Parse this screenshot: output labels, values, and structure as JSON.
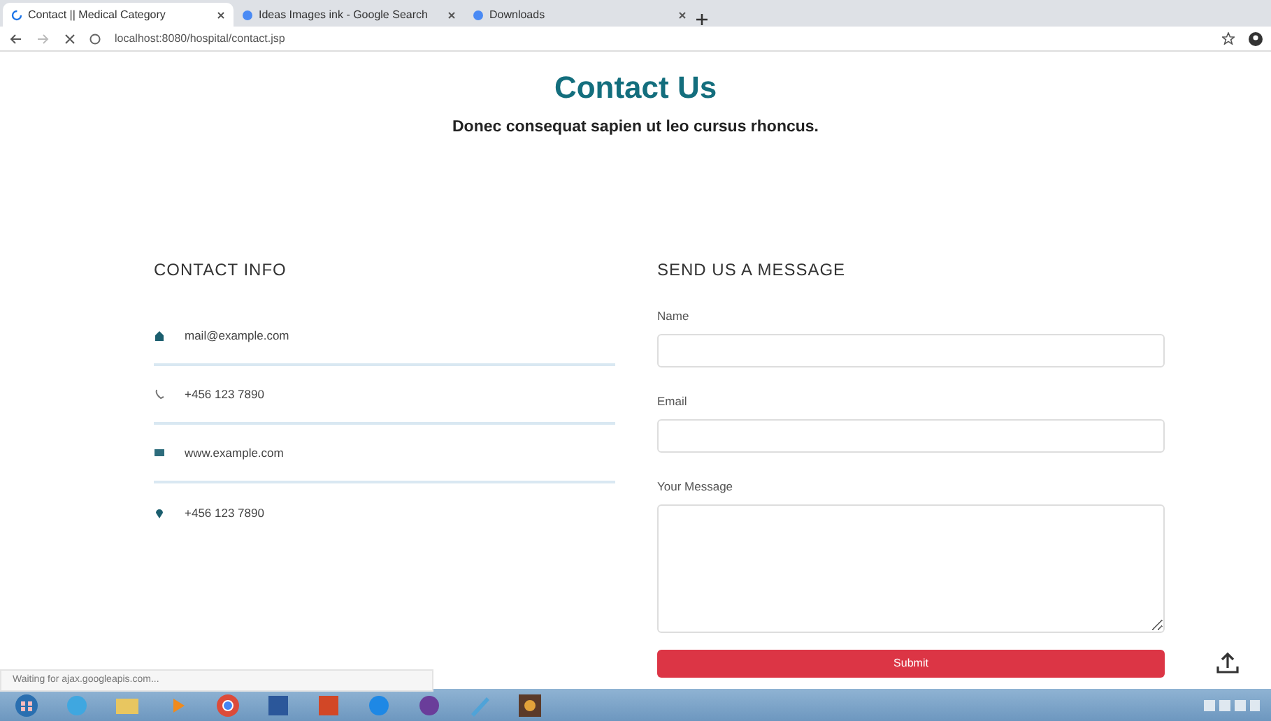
{
  "browser": {
    "tabs": [
      {
        "title": "Contact || Medical Category",
        "selected": true,
        "loading": true
      },
      {
        "title": "Ideas Images ink - Google Search",
        "selected": false,
        "loading": false
      },
      {
        "title": "Downloads",
        "selected": false,
        "loading": false
      }
    ],
    "url": "localhost:8080/hospital/contact.jsp",
    "status": "Waiting for ajax.googleapis.com..."
  },
  "page": {
    "title": "Contact Us",
    "subtitle": "Donec consequat sapien ut leo cursus rhoncus.",
    "contact_info": {
      "heading": "CONTACT INFO",
      "items": [
        {
          "kind": "mail",
          "text": "mail@example.com"
        },
        {
          "kind": "phone",
          "text": "+456 123 7890"
        },
        {
          "kind": "web",
          "text": "www.example.com"
        },
        {
          "kind": "location",
          "text": "+456 123 7890"
        }
      ]
    },
    "form": {
      "heading": "SEND US A MESSAGE",
      "fields": [
        {
          "kind": "input",
          "label": "Name"
        },
        {
          "kind": "input",
          "label": "Email"
        },
        {
          "kind": "textarea",
          "label": "Your Message"
        }
      ],
      "submit": "Submit"
    }
  },
  "taskbar": {
    "apps": [
      {
        "kind": "start"
      },
      {
        "kind": "ie"
      },
      {
        "kind": "folder"
      },
      {
        "kind": "media"
      },
      {
        "kind": "chrome"
      },
      {
        "kind": "word"
      },
      {
        "kind": "powerpoint"
      },
      {
        "kind": "blue"
      },
      {
        "kind": "game"
      },
      {
        "kind": "paint"
      },
      {
        "kind": "photo"
      }
    ]
  }
}
